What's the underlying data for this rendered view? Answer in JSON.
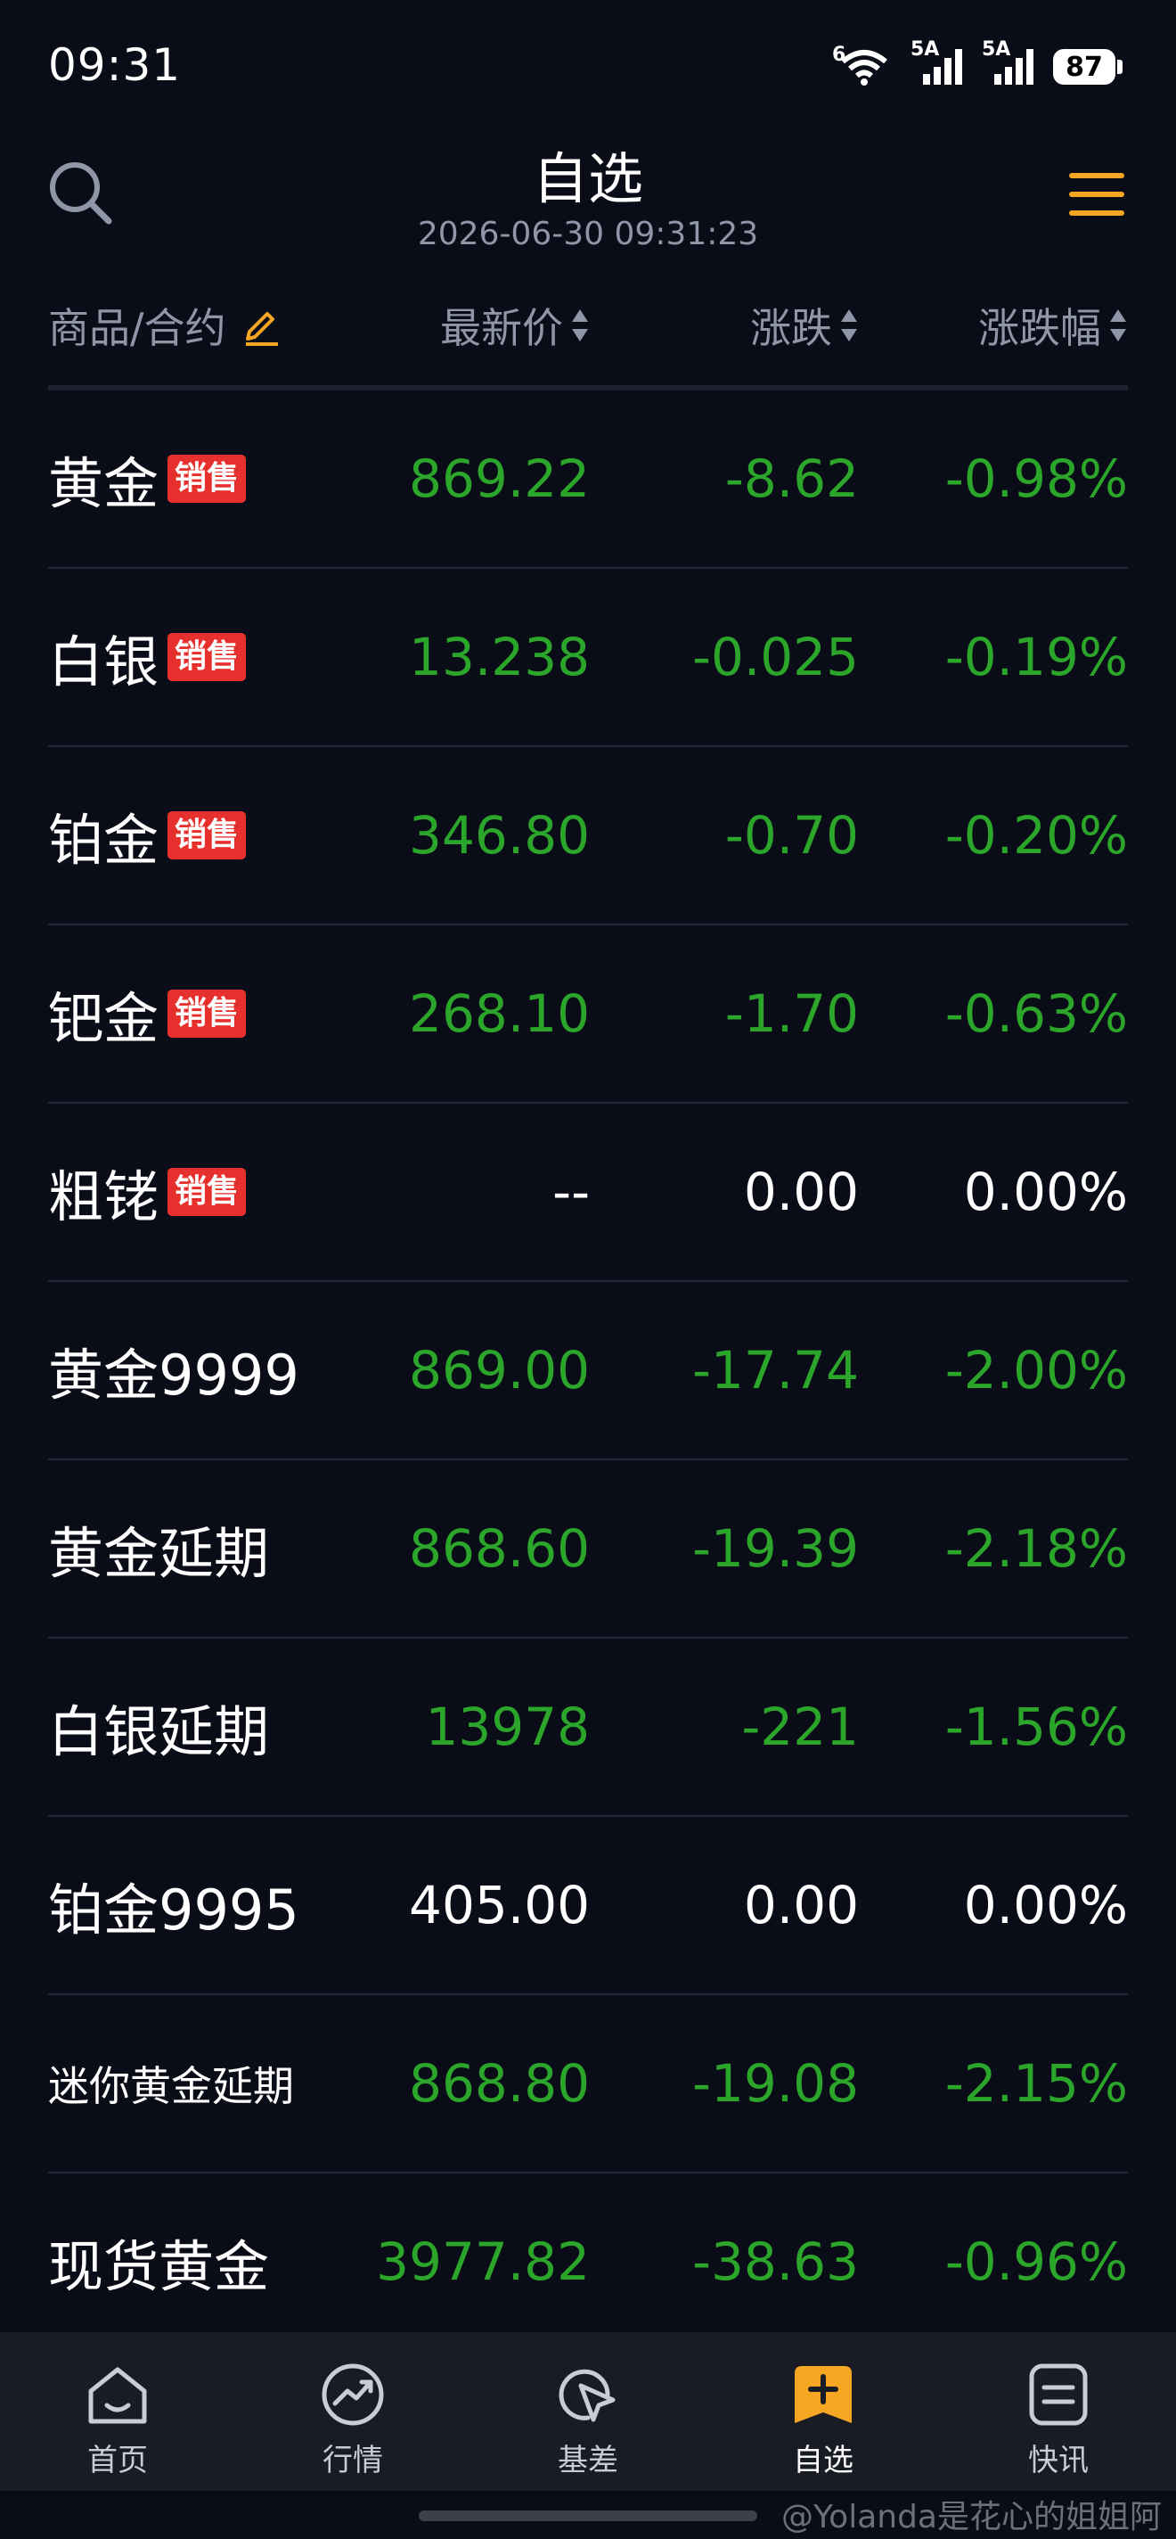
{
  "status_bar": {
    "time": "09:31",
    "wifi_label": "6",
    "signal1_label": "5A",
    "signal2_label": "5A",
    "battery": "87"
  },
  "header": {
    "title": "自选",
    "timestamp": "2026-06-30 09:31:23"
  },
  "columns": {
    "name": "商品/合约",
    "price": "最新价",
    "change": "涨跌",
    "change_pct": "涨跌幅"
  },
  "rows": [
    {
      "name": "黄金",
      "tag": "销售",
      "price": "869.22",
      "change": "-8.62",
      "pct": "-0.98%",
      "trend": "down"
    },
    {
      "name": "白银",
      "tag": "销售",
      "price": "13.238",
      "change": "-0.025",
      "pct": "-0.19%",
      "trend": "down"
    },
    {
      "name": "铂金",
      "tag": "销售",
      "price": "346.80",
      "change": "-0.70",
      "pct": "-0.20%",
      "trend": "down"
    },
    {
      "name": "钯金",
      "tag": "销售",
      "price": "268.10",
      "change": "-1.70",
      "pct": "-0.63%",
      "trend": "down"
    },
    {
      "name": "粗铑",
      "tag": "销售",
      "price": "--",
      "change": "0.00",
      "pct": "0.00%",
      "trend": "flat"
    },
    {
      "name": "黄金9999",
      "tag": "",
      "price": "869.00",
      "change": "-17.74",
      "pct": "-2.00%",
      "trend": "down"
    },
    {
      "name": "黄金延期",
      "tag": "",
      "price": "868.60",
      "change": "-19.39",
      "pct": "-2.18%",
      "trend": "down"
    },
    {
      "name": "白银延期",
      "tag": "",
      "price": "13978",
      "change": "-221",
      "pct": "-1.56%",
      "trend": "down"
    },
    {
      "name": "铂金9995",
      "tag": "",
      "price": "405.00",
      "change": "0.00",
      "pct": "0.00%",
      "trend": "flat"
    },
    {
      "name": "迷你黄金延期",
      "tag": "",
      "price": "868.80",
      "change": "-19.08",
      "pct": "-2.15%",
      "trend": "down"
    },
    {
      "name": "现货黄金",
      "tag": "",
      "price": "3977.82",
      "change": "-38.63",
      "pct": "-0.96%",
      "trend": "down"
    }
  ],
  "tabs": [
    {
      "label": "首页",
      "icon": "home-icon"
    },
    {
      "label": "行情",
      "icon": "market-trend-icon"
    },
    {
      "label": "基差",
      "icon": "basis-cursor-icon"
    },
    {
      "label": "自选",
      "icon": "watchlist-add-icon"
    },
    {
      "label": "快讯",
      "icon": "news-flash-icon"
    }
  ],
  "watermark": "@Yolanda是花心的姐姐阿",
  "colors": {
    "background": "#0a0d17",
    "down": "#2ba62b",
    "flat": "#ffffff",
    "accent": "#f5a623",
    "tag": "#e6302e",
    "tabbar": "#191c25"
  }
}
